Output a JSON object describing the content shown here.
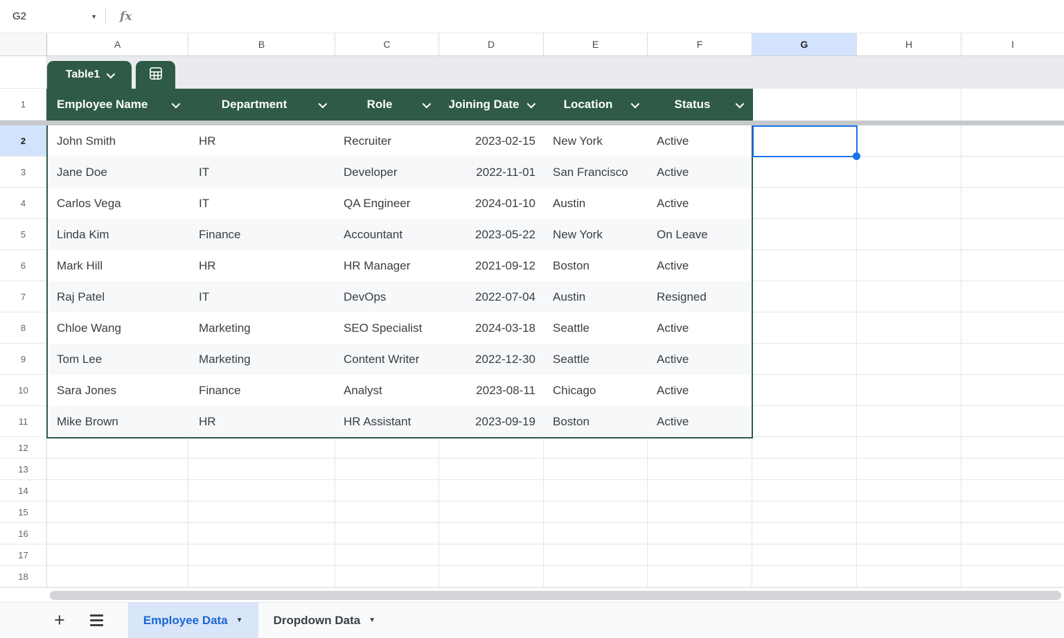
{
  "name_box": {
    "value": "G2"
  },
  "formula_bar": {
    "fx": "fx"
  },
  "icons": {
    "dropdown_triangle": "▼",
    "plus": "+"
  },
  "columns": {
    "letters": [
      "A",
      "B",
      "C",
      "D",
      "E",
      "F",
      "G",
      "H",
      "I"
    ],
    "selected": "G"
  },
  "row_numbers": [
    "1",
    "2",
    "3",
    "4",
    "5",
    "6",
    "7",
    "8",
    "9",
    "10",
    "11",
    "12",
    "13",
    "14",
    "15",
    "16",
    "17",
    "18"
  ],
  "selected_cell": "G2",
  "table": {
    "name": "Table1",
    "headers": [
      "Employee Name",
      "Department",
      "Role",
      "Joining Date",
      "Location",
      "Status"
    ],
    "rows": [
      {
        "name": "John Smith",
        "department": "HR",
        "role": "Recruiter",
        "date": "2023-02-15",
        "location": "New York",
        "status": "Active"
      },
      {
        "name": "Jane Doe",
        "department": "IT",
        "role": "Developer",
        "date": "2022-11-01",
        "location": "San Francisco",
        "status": "Active"
      },
      {
        "name": "Carlos Vega",
        "department": "IT",
        "role": "QA Engineer",
        "date": "2024-01-10",
        "location": "Austin",
        "status": "Active"
      },
      {
        "name": "Linda Kim",
        "department": "Finance",
        "role": "Accountant",
        "date": "2023-05-22",
        "location": "New York",
        "status": "On Leave"
      },
      {
        "name": "Mark Hill",
        "department": "HR",
        "role": "HR Manager",
        "date": "2021-09-12",
        "location": "Boston",
        "status": "Active"
      },
      {
        "name": "Raj Patel",
        "department": "IT",
        "role": "DevOps",
        "date": "2022-07-04",
        "location": "Austin",
        "status": "Resigned"
      },
      {
        "name": "Chloe Wang",
        "department": "Marketing",
        "role": "SEO Specialist",
        "date": "2024-03-18",
        "location": "Seattle",
        "status": "Active"
      },
      {
        "name": "Tom Lee",
        "department": "Marketing",
        "role": "Content Writer",
        "date": "2022-12-30",
        "location": "Seattle",
        "status": "Active"
      },
      {
        "name": "Sara Jones",
        "department": "Finance",
        "role": "Analyst",
        "date": "2023-08-11",
        "location": "Chicago",
        "status": "Active"
      },
      {
        "name": "Mike Brown",
        "department": "HR",
        "role": "HR Assistant",
        "date": "2023-09-19",
        "location": "Boston",
        "status": "Active"
      }
    ]
  },
  "sheet_tabs": [
    {
      "label": "Employee Data",
      "active": true
    },
    {
      "label": "Dropdown Data",
      "active": false
    }
  ],
  "colors": {
    "table_header_green": "#2E5A46",
    "selection_blue": "#1A73E8",
    "selected_header_bg": "#D3E3FD",
    "active_tab_bg": "#D9E5F9",
    "active_tab_text": "#1967D2",
    "band_row_bg": "#F6F8FA"
  }
}
